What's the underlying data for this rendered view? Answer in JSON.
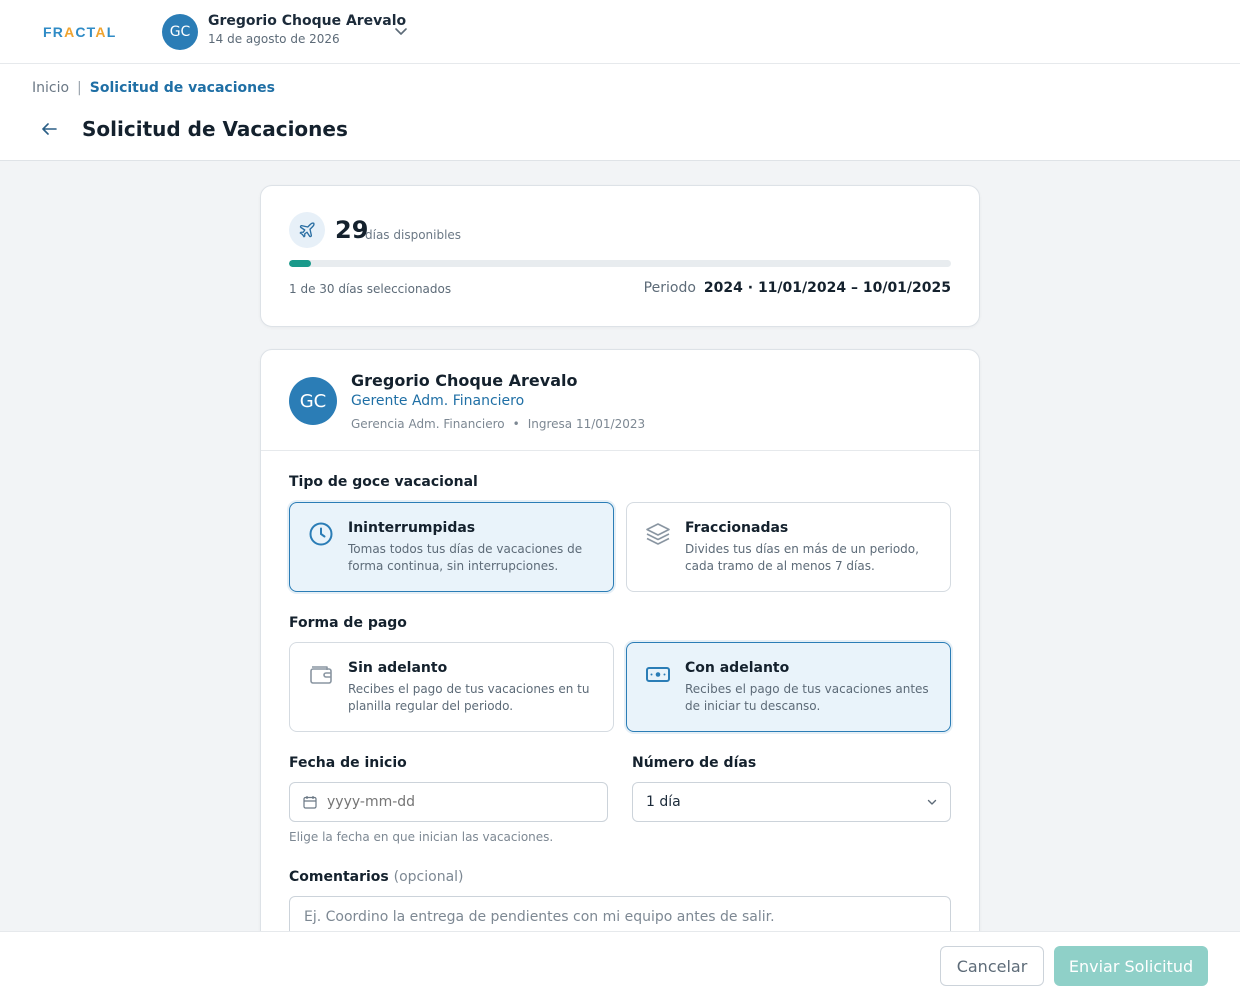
{
  "topbar": {
    "logo": {
      "part1": "FR",
      "part2": "A",
      "part3": "CT",
      "part4": "A",
      "part5": "L"
    },
    "user": {
      "initials": "GC",
      "name": "Gregorio Choque Arevalo",
      "date": "14 de agosto de 2026"
    }
  },
  "breadcrumb": {
    "home": "Inicio",
    "separator": "|",
    "current": "Solicitud de vacaciones"
  },
  "page": {
    "title": "Solicitud de Vacaciones"
  },
  "availability": {
    "days": "29",
    "days_label": "días disponibles",
    "selected_fraction": 0.0333,
    "selected_text": "1 de 30 días seleccionados",
    "period_label": "Periodo",
    "period_value": "2024 · 11/01/2024 – 10/01/2025"
  },
  "employee": {
    "initials": "GC",
    "name": "Gregorio Choque Arevalo",
    "role": "Gerente Adm. Financiero",
    "department": "Gerencia Adm. Financiero",
    "meta_sep": "•",
    "hire": "Ingresa 11/01/2023"
  },
  "vacation_type": {
    "title": "Tipo de goce vacacional",
    "options": [
      {
        "title": "Ininterrumpidas",
        "desc": "Tomas todos tus días de vacaciones de forma continua, sin interrupciones.",
        "icon": "clock-icon",
        "selected": true
      },
      {
        "title": "Fraccionadas",
        "desc": "Divides tus días en más de un periodo, cada tramo de al menos 7 días.",
        "icon": "layers-icon",
        "selected": false
      }
    ]
  },
  "payment": {
    "title": "Forma de pago",
    "options": [
      {
        "title": "Sin adelanto",
        "desc": "Recibes el pago de tus vacaciones en tu planilla regular del periodo.",
        "icon": "wallet-icon",
        "selected": false
      },
      {
        "title": "Con adelanto",
        "desc": "Recibes el pago de tus vacaciones antes de iniciar tu descanso.",
        "icon": "cash-icon",
        "selected": true
      }
    ]
  },
  "start_date": {
    "label": "Fecha de inicio",
    "placeholder": "yyyy-mm-dd",
    "hint": "Elige la fecha en que inician las vacaciones."
  },
  "num_days": {
    "label": "Número de días",
    "value": "1 día"
  },
  "comments": {
    "label": "Comentarios",
    "optional": "(opcional)",
    "placeholder": "Ej. Coordino la entrega de pendientes con mi equipo antes de salir."
  },
  "footer": {
    "cancel": "Cancelar",
    "submit": "Enviar Solicitud"
  },
  "colors": {
    "primary": "#2b7db6",
    "accent": "#1a9a8b",
    "submit_disabled": "#8fd0c8",
    "selected_bg": "#e9f3fa"
  }
}
